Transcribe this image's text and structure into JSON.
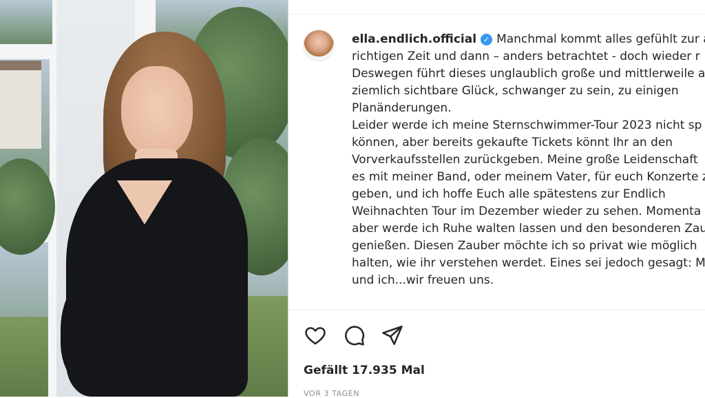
{
  "post": {
    "username": "ella.endlich.official",
    "verified_icon": "verified-badge-icon",
    "caption_lines": [
      "Manchmal kommt alles gefühlt zur ab",
      "richtigen Zeit und dann – anders betrachtet - doch wieder r",
      "Deswegen führt dieses unglaublich große und mittlerweile a",
      "ziemlich sichtbare Glück, schwanger zu sein, zu einigen",
      "Planänderungen.",
      "Leider werde ich meine Sternschwimmer-Tour 2023 nicht sp",
      "können, aber bereits gekaufte Tickets könnt Ihr an den",
      "Vorverkaufsstellen zurückgeben. Meine große Leidenschaft",
      "es mit meiner Band, oder meinem Vater, für euch Konzerte z",
      "geben, und ich hoffe Euch alle spätestens zur Endlich",
      "Weihnachten Tour im Dezember wieder zu sehen. Momenta",
      "aber werde ich Ruhe walten lassen und den besonderen Zau",
      "genießen. Diesen Zauber möchte ich so privat wie möglich",
      "halten, wie ihr verstehen werdet. Eines sei jedoch gesagt: M",
      "und ich...wir freuen uns."
    ],
    "likes": "Gefällt 17.935 Mal",
    "timestamp": "VOR 3 TAGEN",
    "icons": [
      "heart-icon",
      "comment-icon",
      "share-icon"
    ]
  },
  "colors": {
    "text": "#262626",
    "verified": "#3897f0",
    "muted": "#8e8e8e",
    "dress": "#15161a"
  }
}
